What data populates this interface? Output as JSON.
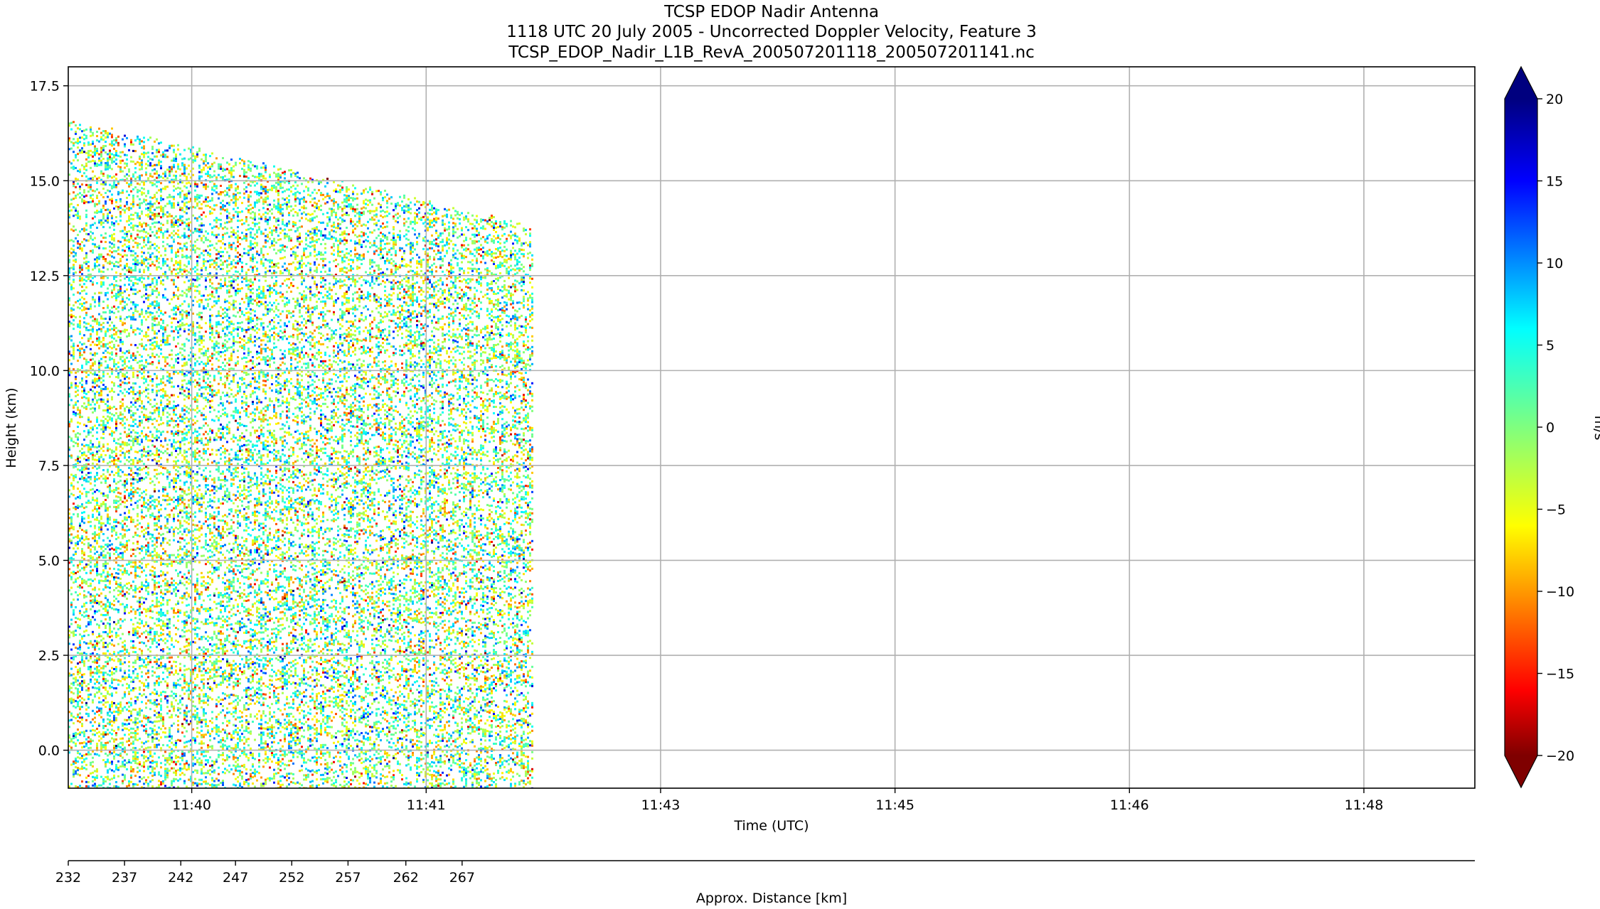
{
  "chart_data": {
    "type": "heatmap",
    "title_lines": [
      "TCSP EDOP Nadir Antenna",
      "1118 UTC 20 July 2005 - Uncorrected Doppler Velocity, Feature 3",
      "TCSP_EDOP_Nadir_L1B_RevA_200507201118_200507201141.nc"
    ],
    "xlabel": "Time (UTC)",
    "ylabel": "Height (km)",
    "x_axis": {
      "unit": "minutes after 11:00 UTC",
      "range": [
        39.21,
        48.21
      ],
      "ticks": [
        {
          "value": 40.0,
          "label": "11:40"
        },
        {
          "value": 41.5,
          "label": "11:41"
        },
        {
          "value": 43.0,
          "label": "11:43"
        },
        {
          "value": 44.5,
          "label": "11:45"
        },
        {
          "value": 46.0,
          "label": "11:46"
        },
        {
          "value": 47.5,
          "label": "11:48"
        }
      ]
    },
    "y_axis": {
      "range": [
        -1.0,
        18.0
      ],
      "ticks": [
        0.0,
        2.5,
        5.0,
        7.5,
        10.0,
        12.5,
        15.0,
        17.5
      ],
      "tick_labels": [
        "0.0",
        "2.5",
        "5.0",
        "7.5",
        "10.0",
        "12.5",
        "15.0",
        "17.5"
      ]
    },
    "secondary_x_axis": {
      "label": "Approx. Distance [km]",
      "ticks": [
        {
          "label": "232",
          "time": 39.21
        },
        {
          "label": "237",
          "time": 39.57
        },
        {
          "label": "242",
          "time": 39.93
        },
        {
          "label": "247",
          "time": 40.28
        },
        {
          "label": "252",
          "time": 40.64
        },
        {
          "label": "257",
          "time": 41.0
        },
        {
          "label": "262",
          "time": 41.37
        },
        {
          "label": "267",
          "time": 41.73
        }
      ]
    },
    "data_extent": {
      "x_start": 39.21,
      "x_end": 42.18,
      "top_height_start": 16.6,
      "top_height_end": 13.8,
      "bottom_height": -1.0
    },
    "colorbar": {
      "label": "m/s",
      "vmin": -20,
      "vmax": 20,
      "ticks": [
        -20,
        -15,
        -10,
        -5,
        0,
        5,
        10,
        15,
        20
      ],
      "tick_labels": [
        "−20",
        "−15",
        "−10",
        "−5",
        "0",
        "5",
        "10",
        "15",
        "20"
      ],
      "colormap": "jet",
      "extend": "both",
      "colors": [
        "#00007f",
        "#0000ff",
        "#007fff",
        "#00ffff",
        "#7fff7f",
        "#ffff00",
        "#ff7f00",
        "#ff0000",
        "#7f0000"
      ]
    },
    "grid": true
  }
}
